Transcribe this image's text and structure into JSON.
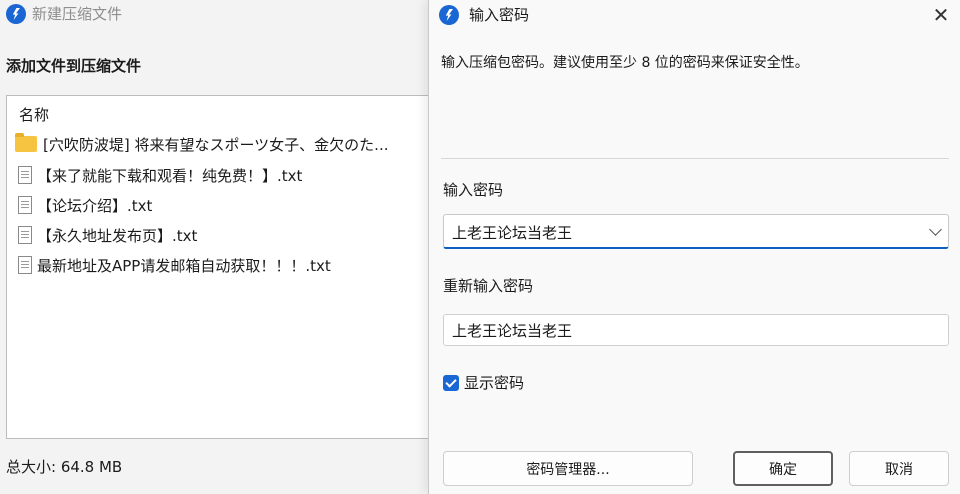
{
  "background_window": {
    "title": "新建压缩文件",
    "heading": "添加文件到压缩文件",
    "list_header": "名称",
    "files": [
      {
        "name": "[穴吹防波堤] 将来有望なスポーツ女子、金欠のた...",
        "icon": "folder-icon"
      },
      {
        "name": "【来了就能下载和观看！纯免费！】.txt",
        "icon": "text-file-icon"
      },
      {
        "name": "【论坛介绍】.txt",
        "icon": "text-file-icon"
      },
      {
        "name": "【永久地址发布页】.txt",
        "icon": "text-file-icon"
      },
      {
        "name": "最新地址及APP请发邮箱自动获取！！！.txt",
        "icon": "text-file-icon"
      }
    ],
    "total_size": "总大小: 64.8 MB"
  },
  "dialog": {
    "title": "输入密码",
    "close_glyph": "✕",
    "info_text": "输入压缩包密码。建议使用至少 8 位的密码来保证安全性。",
    "password_label": "输入密码",
    "password_value": "上老王论坛当老王",
    "confirm_label": "重新输入密码",
    "confirm_value": "上老王论坛当老王",
    "show_password_label": "显示密码",
    "show_password_checked": true,
    "buttons": {
      "manager": "密码管理器...",
      "ok": "确定",
      "cancel": "取消"
    }
  },
  "colors": {
    "accent": "#1a66d2",
    "folder": "#f7c441"
  }
}
